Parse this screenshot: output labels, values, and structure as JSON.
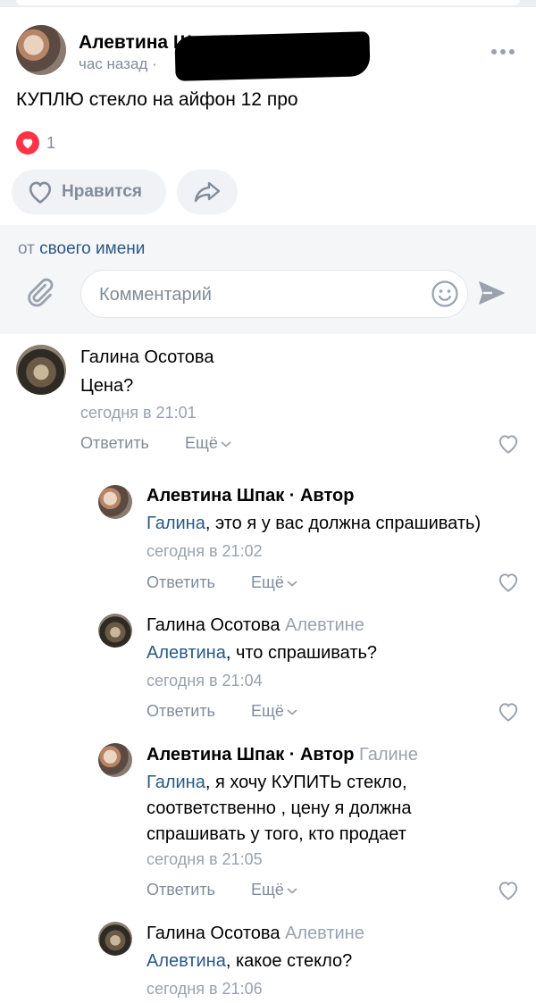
{
  "post": {
    "author": "Алевтина Шпак",
    "time": "час назад",
    "text": "КУПЛЮ стекло на айфон 12 про",
    "likes": "1",
    "like_label": "Нравится"
  },
  "composer": {
    "from_prefix": "от",
    "from_link": "своего имени",
    "placeholder": "Комментарий"
  },
  "labels": {
    "reply": "Ответить",
    "more": "Ещё"
  },
  "comments": [
    {
      "author": "Галина Осотова",
      "author_suffix": "",
      "to": "",
      "mention": "",
      "text": "Цена?",
      "time": "сегодня в 21:01"
    },
    {
      "author": "Алевтина Шпак",
      "author_suffix": " · Автор",
      "to": "",
      "mention": "Галина",
      "text": ", это я у вас должна спрашивать)",
      "time": "сегодня в 21:02"
    },
    {
      "author": "Галина Осотова",
      "author_suffix": "",
      "to": "Алевтине",
      "mention": "Алевтина",
      "text": ", что спрашивать?",
      "time": "сегодня в 21:04"
    },
    {
      "author": "Алевтина Шпак",
      "author_suffix": " · Автор",
      "to": "Галине",
      "mention": "Галина",
      "text": ", я хочу КУПИТЬ стекло,",
      "text_line2": "соответственно , цену я должна",
      "text_line3": "спрашивать у того, кто продает",
      "time": "сегодня в 21:05"
    },
    {
      "author": "Галина Осотова",
      "author_suffix": "",
      "to": "Алевтине",
      "mention": "Алевтина",
      "text": ", какое стекло?",
      "time": "сегодня в 21:06"
    }
  ]
}
